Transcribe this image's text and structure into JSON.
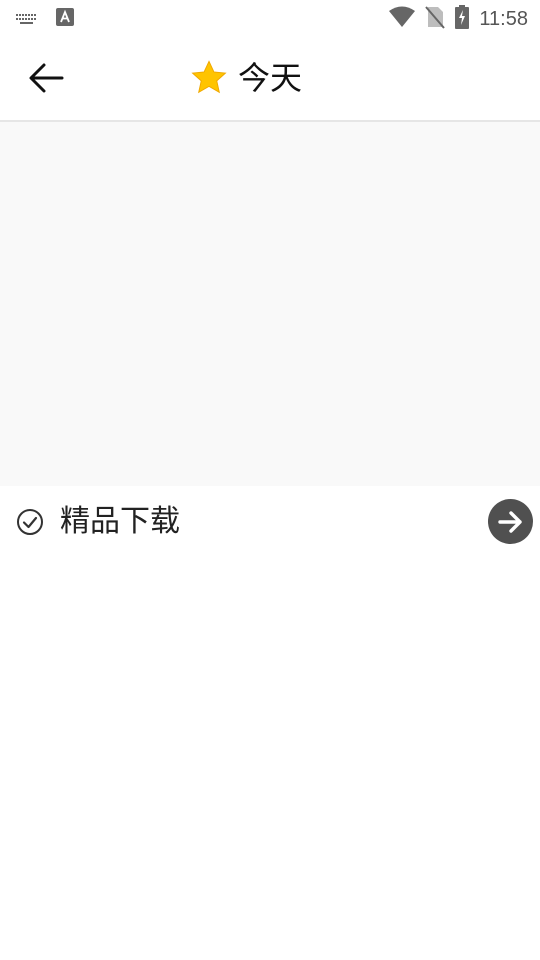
{
  "status_bar": {
    "time": "11:58",
    "icons": [
      "keyboard-icon",
      "text-a-icon",
      "wifi-icon",
      "no-sim-icon",
      "battery-charging-icon"
    ]
  },
  "header": {
    "back_icon": "arrow-left-icon",
    "star_icon": "star-icon",
    "title": "今天"
  },
  "list": {
    "items": [
      {
        "icon": "check-circle-icon",
        "label": "精品下载",
        "action_icon": "arrow-right-circle-icon"
      }
    ]
  },
  "colors": {
    "star": "#FFC400",
    "content_bg": "#F9F9F9",
    "arrow_button": "#505050",
    "divider": "#E6E6E6"
  }
}
